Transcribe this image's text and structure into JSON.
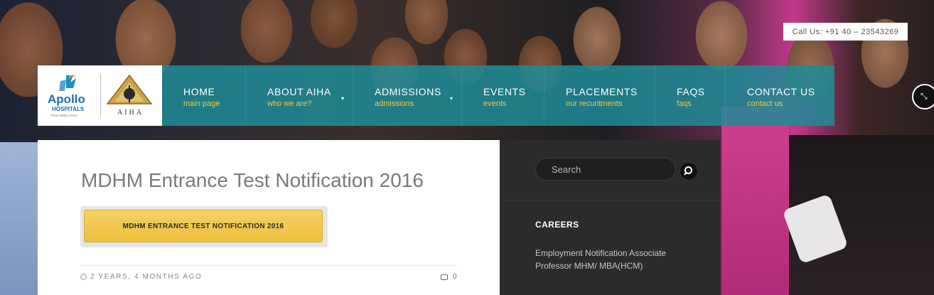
{
  "contact": {
    "call_us": "Call Us: +91 40 – 23543269"
  },
  "branding": {
    "apollo_name": "Apollo",
    "apollo_sub": "HOSPITALS",
    "apollo_tag": "TOUCHING LIVES",
    "aiha": "AIHA"
  },
  "nav": {
    "items": [
      {
        "label": "HOME",
        "sub": "main page"
      },
      {
        "label": "ABOUT AIHA",
        "sub": "who we are?"
      },
      {
        "label": "ADMISSIONS",
        "sub": "admissions"
      },
      {
        "label": "EVENTS",
        "sub": "events"
      },
      {
        "label": "PLACEMENTS",
        "sub": "our recuritments"
      },
      {
        "label": "FAQS",
        "sub": "faqs"
      },
      {
        "label": "CONTACT US",
        "sub": "contact us"
      }
    ]
  },
  "post": {
    "title": "MDHM Entrance Test Notification 2016",
    "button_label": "MDHM ENTRANCE TEST NOTIFICATION 2016",
    "date": "2 YEARS, 4 MONTHS AGO",
    "comments": "0"
  },
  "sidebar": {
    "search_placeholder": "Search",
    "careers_title": "CAREERS",
    "careers_link": "Employment Notification Associate Professor MHM/ MBA(HCM)"
  },
  "colors": {
    "nav_bg": "#1e8c96",
    "nav_sub": "#f2c94c",
    "button": "#f0c440",
    "sidebar_bg": "#2b2b2b"
  }
}
